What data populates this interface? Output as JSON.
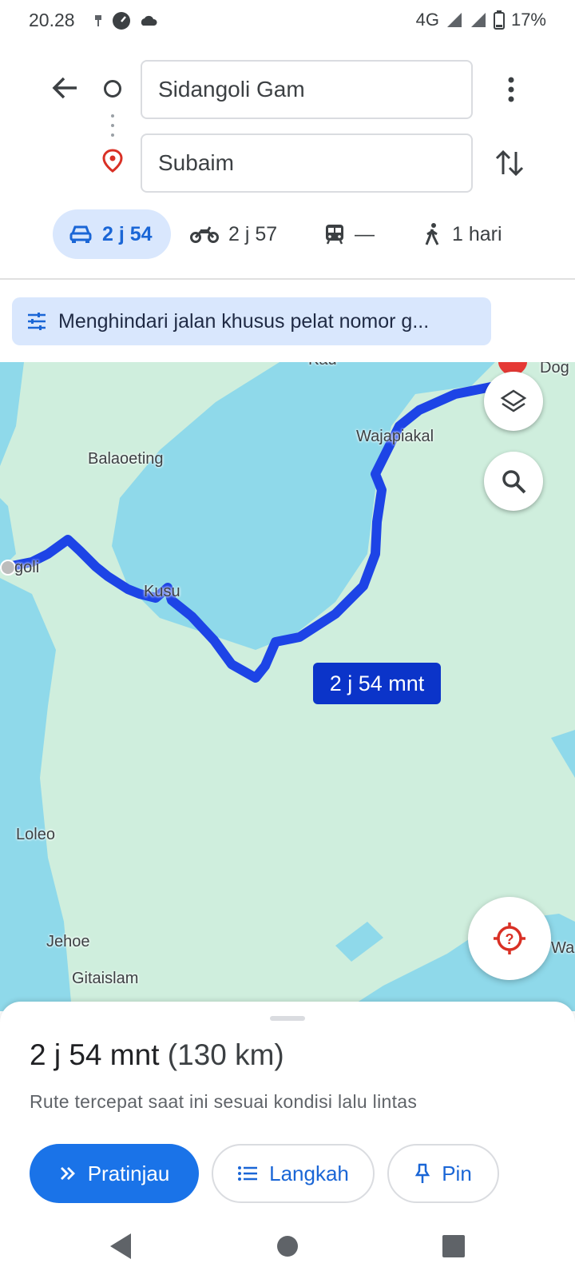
{
  "status_bar": {
    "time": "20.28",
    "network": "4G",
    "battery": "17%"
  },
  "directions": {
    "origin": "Sidangoli Gam",
    "destination": "Subaim"
  },
  "modes": [
    {
      "icon": "car-icon",
      "label": "2 j 54",
      "selected": true
    },
    {
      "icon": "motorcycle-icon",
      "label": "2 j 57",
      "selected": false
    },
    {
      "icon": "transit-icon",
      "label": "—",
      "selected": false
    },
    {
      "icon": "walk-icon",
      "label": "1 hari",
      "selected": false
    }
  ],
  "options_chip": {
    "label": "Menghindari jalan khusus pelat nomor g..."
  },
  "map": {
    "places": {
      "kau": "Kau",
      "dog": "Dog",
      "wajapiakal": "Wajapiakal",
      "balaoeting": "Balaoeting",
      "goli": "goli",
      "kusu": "Kusu",
      "loleo": "Loleo",
      "jehoe": "Jehoe",
      "gitaislam": "Gitaislam",
      "wa": "Wa"
    },
    "route_label": "2 j 54 mnt",
    "colors": {
      "land": "#cfeedd",
      "water": "#8fd9ea",
      "route": "#1d44e6"
    }
  },
  "sheet": {
    "duration": "2 j 54 mnt",
    "distance": "(130 km)",
    "subtitle": "Rute tercepat saat ini sesuai kondisi lalu lintas",
    "buttons": {
      "preview": "Pratinjau",
      "steps": "Langkah",
      "pin": "Pin"
    }
  },
  "colors": {
    "accent": "#1a73e8",
    "chip_bg": "#d9e7fd",
    "route_label_bg": "#0b34c9"
  }
}
